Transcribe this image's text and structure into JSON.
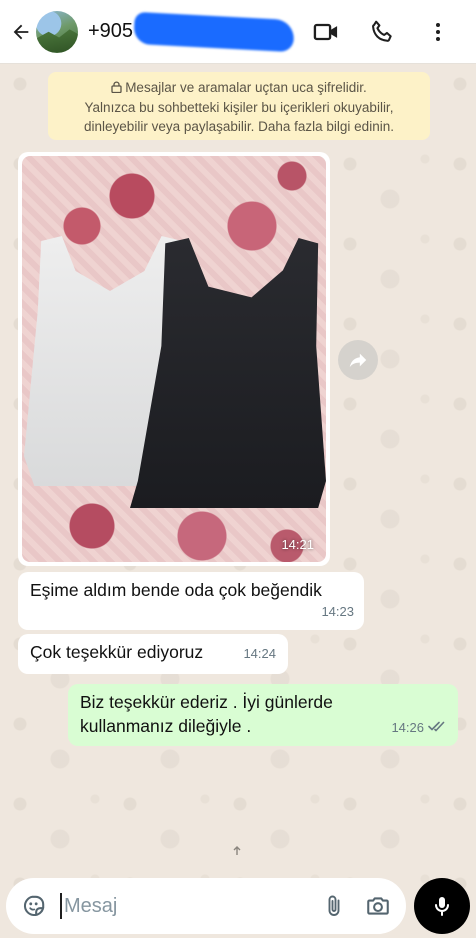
{
  "header": {
    "contact_name": "+905",
    "icons": [
      "back-arrow-icon",
      "video-call-icon",
      "voice-call-icon",
      "more-options-icon"
    ]
  },
  "notice": {
    "line1": "Mesajlar ve aramalar uçtan uca şifrelidir.",
    "line2": "Yalnızca bu sohbetteki kişiler bu içerikleri okuyabilir,",
    "line3": "dinleyebilir veya paylaşabilir. Daha fazla bilgi edinin."
  },
  "messages": [
    {
      "type": "image",
      "direction": "incoming",
      "time": "14:21"
    },
    {
      "type": "text",
      "direction": "incoming",
      "text": "Eşime aldım bende oda çok beğendik",
      "time": "14:23"
    },
    {
      "type": "text",
      "direction": "incoming",
      "text": "Çok teşekkür ediyoruz",
      "time": "14:24"
    },
    {
      "type": "text",
      "direction": "outgoing",
      "line1": "Biz teşekkür ederiz . İyi günlerde",
      "line2": "kullanmanız dileğiyle .",
      "time": "14:26",
      "status": "read"
    }
  ],
  "composer": {
    "placeholder": "Mesaj",
    "value": ""
  },
  "colors": {
    "chat_background": "#efe7de",
    "incoming_bubble": "#ffffff",
    "outgoing_bubble": "#d9fdd3",
    "notice_background": "#fdf2c8",
    "read_ticks": "#667781",
    "mic_button": "#000000"
  }
}
